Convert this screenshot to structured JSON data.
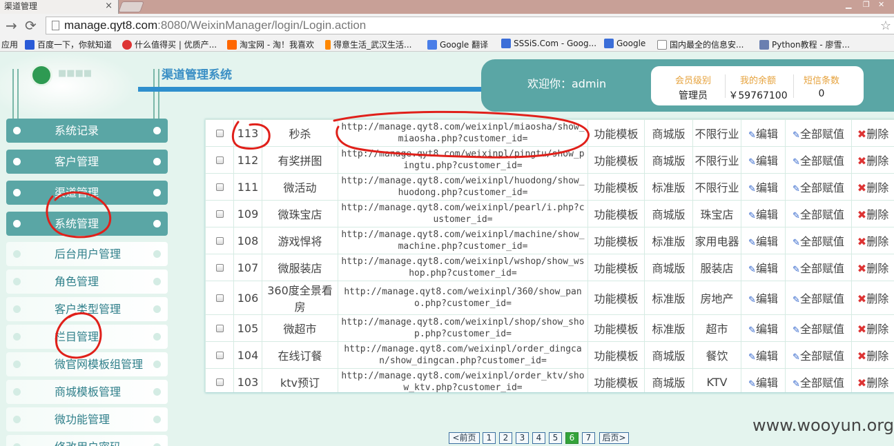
{
  "browser": {
    "tab_title": "渠道管理",
    "tab_close": "×",
    "url_host": "manage.qyt8.com",
    "url_port": ":8080",
    "url_path": "/WeixinManager/login/Login.action",
    "bookmarks": [
      "应用",
      "百度一下，你就知道",
      "什么值得买 | 优质产...",
      "淘宝网 - 淘！我喜欢",
      "得意生活_武汉生活...",
      "Google 翻译",
      "SSSiS.Com - Goog...",
      "Google",
      "国内最全的信息安...",
      "Python教程 - 廖雪..."
    ]
  },
  "header": {
    "app_title": "渠道管理系统",
    "welcome": "欢迎你：admin",
    "info": [
      {
        "label": "会员级别",
        "value": "管理员"
      },
      {
        "label": "我的余额",
        "value": "￥59767100"
      },
      {
        "label": "短信条数",
        "value": "0"
      }
    ]
  },
  "sidebar": {
    "main_items": [
      "系统记录",
      "客户管理",
      "渠道管理",
      "系统管理"
    ],
    "sub_items": [
      "后台用户管理",
      "角色管理",
      "客户类型管理",
      "栏目管理",
      "微官网模板组管理",
      "商城模板管理",
      "微功能管理",
      "修改用户密码"
    ]
  },
  "table": {
    "actions": {
      "edit": "编辑",
      "assign": "全部赋值",
      "delete": "删除"
    },
    "rows": [
      {
        "id": "113",
        "name": "秒杀",
        "url": "http://manage.qyt8.com/weixinpl/miaosha/show_miaosha.php?customer_id=",
        "type": "功能模板",
        "edition": "商城版",
        "industry": "不限行业"
      },
      {
        "id": "112",
        "name": "有奖拼图",
        "url": "http://manage.qyt8.com/weixinpl/pingtu/show_pingtu.php?customer_id=",
        "type": "功能模板",
        "edition": "商城版",
        "industry": "不限行业"
      },
      {
        "id": "111",
        "name": "微活动",
        "url": "http://manage.qyt8.com/weixinpl/huodong/show_huodong.php?customer_id=",
        "type": "功能模板",
        "edition": "标准版",
        "industry": "不限行业"
      },
      {
        "id": "109",
        "name": "微珠宝店",
        "url": "http://manage.qyt8.com/weixinpl/pearl/i.php?customer_id=",
        "type": "功能模板",
        "edition": "商城版",
        "industry": "珠宝店"
      },
      {
        "id": "108",
        "name": "游戏悍将",
        "url": "http://manage.qyt8.com/weixinpl/machine/show_machine.php?customer_id=",
        "type": "功能模板",
        "edition": "标准版",
        "industry": "家用电器"
      },
      {
        "id": "107",
        "name": "微服装店",
        "url": "http://manage.qyt8.com/weixinpl/wshop/show_wshop.php?customer_id=",
        "type": "功能模板",
        "edition": "商城版",
        "industry": "服装店"
      },
      {
        "id": "106",
        "name": "360度全景看房",
        "url": "http://manage.qyt8.com/weixinpl/360/show_pano.php?customer_id=",
        "type": "功能模板",
        "edition": "标准版",
        "industry": "房地产"
      },
      {
        "id": "105",
        "name": "微超市",
        "url": "http://manage.qyt8.com/weixinpl/shop/show_shop.php?customer_id=",
        "type": "功能模板",
        "edition": "标准版",
        "industry": "超市"
      },
      {
        "id": "104",
        "name": "在线订餐",
        "url": "http://manage.qyt8.com/weixinpl/order_dingcan/show_dingcan.php?customer_id=",
        "type": "功能模板",
        "edition": "商城版",
        "industry": "餐饮"
      },
      {
        "id": "103",
        "name": "ktv预订",
        "url": "http://manage.qyt8.com/weixinpl/order_ktv/show_ktv.php?customer_id=",
        "type": "功能模板",
        "edition": "商城版",
        "industry": "KTV"
      }
    ]
  },
  "pagination": {
    "prev": "<前页",
    "pages": [
      "1",
      "2",
      "3",
      "4",
      "5",
      "6",
      "7"
    ],
    "current": "6",
    "next": "后页>"
  },
  "watermark": "www.wooyun.org",
  "colors": {
    "accent": "#5aa6a5",
    "annotation": "#e0201a",
    "title_blue": "#3a8fc5"
  }
}
